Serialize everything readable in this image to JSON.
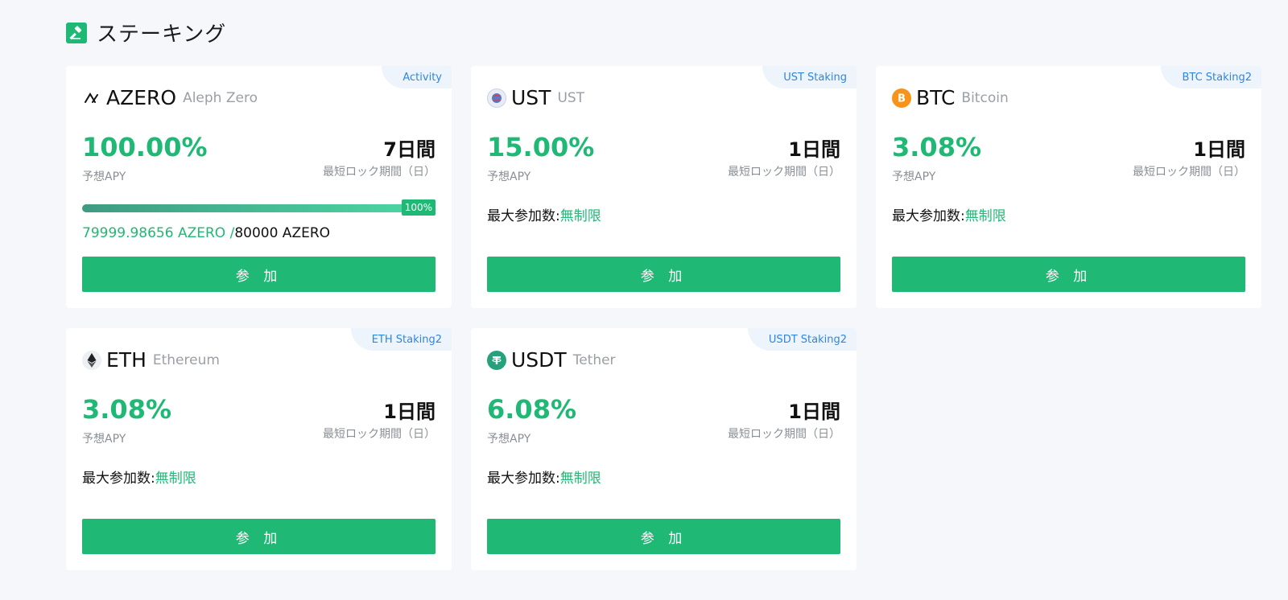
{
  "page": {
    "title": "ステーキング",
    "brand_color": "#1fb874"
  },
  "labels": {
    "apy": "予想APY",
    "lock": "最短ロック期間（日）",
    "max_participants": "最大参加数:",
    "join": "参 加"
  },
  "cards": [
    {
      "tag": "Activity",
      "symbol": "AZERO",
      "name": "Aleph Zero",
      "icon": "aleph-zero-icon",
      "apy": "100.00%",
      "lock_period": "7日間",
      "progress_percent": 100,
      "progress_label": "100%",
      "amount_current": "79999.98656 AZERO",
      "amount_separator": "/",
      "amount_total": "80000 AZERO"
    },
    {
      "tag": "UST Staking",
      "symbol": "UST",
      "name": "UST",
      "icon": "ust-icon",
      "apy": "15.00%",
      "lock_period": "1日間",
      "max_participants_value": "無制限"
    },
    {
      "tag": "BTC Staking2",
      "symbol": "BTC",
      "name": "Bitcoin",
      "icon": "bitcoin-icon",
      "icon_color": "#f7931a",
      "apy": "3.08%",
      "lock_period": "1日間",
      "max_participants_value": "無制限"
    },
    {
      "tag": "ETH Staking2",
      "symbol": "ETH",
      "name": "Ethereum",
      "icon": "ethereum-icon",
      "apy": "3.08%",
      "lock_period": "1日間",
      "max_participants_value": "無制限"
    },
    {
      "tag": "USDT Staking2",
      "symbol": "USDT",
      "name": "Tether",
      "icon": "tether-icon",
      "icon_color": "#26a17b",
      "apy": "6.08%",
      "lock_period": "1日間",
      "max_participants_value": "無制限"
    }
  ]
}
